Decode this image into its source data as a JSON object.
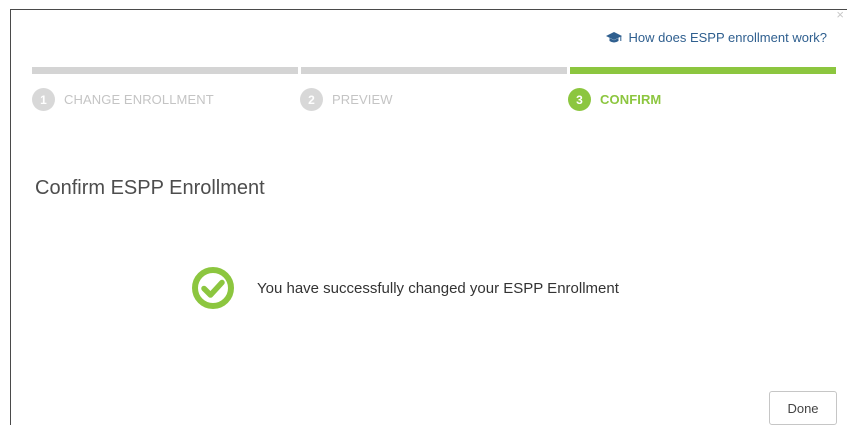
{
  "dialog": {
    "close_glyph": "×",
    "help_link": "How does ESPP enrollment work?",
    "title": "Confirm ESPP Enrollment",
    "success_message": "You have successfully changed your ESPP Enrollment",
    "done_label": "Done"
  },
  "steps": [
    {
      "number": "1",
      "label": "CHANGE ENROLLMENT",
      "active": false
    },
    {
      "number": "2",
      "label": "PREVIEW",
      "active": false
    },
    {
      "number": "3",
      "label": "CONFIRM",
      "active": true
    }
  ],
  "colors": {
    "accent": "#8cc63f",
    "inactive": "#d4d4d4",
    "link": "#2f5f8f"
  },
  "icons": {
    "help": "graduation-cap-icon",
    "success": "check-circle-icon"
  }
}
